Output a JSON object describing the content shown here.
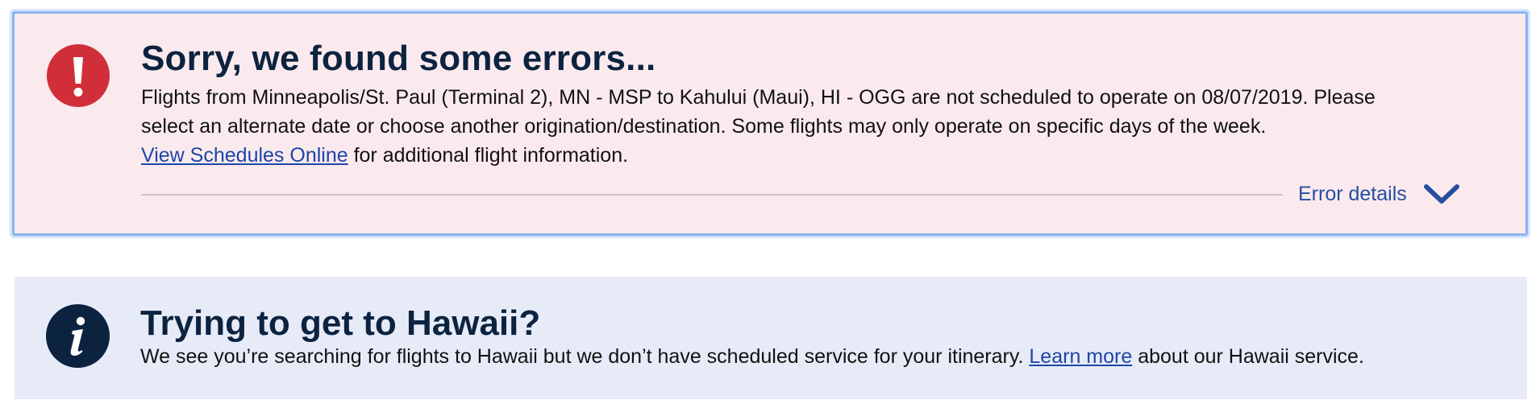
{
  "error_alert": {
    "icon": "exclamation-icon",
    "title": "Sorry, we found some errors...",
    "line1": "Flights from Minneapolis/St. Paul (Terminal 2), MN - MSP to Kahului (Maui), HI - OGG are not scheduled to operate on 08/07/2019. Please",
    "line2": "select an alternate date or choose another origination/destination. Some flights may only operate on specific days of the week.",
    "link_text": "View Schedules Online",
    "after_link": " for additional flight information.",
    "details_label": "Error details",
    "colors": {
      "background": "#faeaee",
      "icon": "#d02f3a",
      "border": "#8ab4f0"
    }
  },
  "info_alert": {
    "icon": "info-icon",
    "title": "Trying to get to Hawaii?",
    "body_before": "We see you’re searching for flights to Hawaii but we don’t have scheduled service for your itinerary. ",
    "link_text": "Learn more",
    "body_after": " about our Hawaii service.",
    "colors": {
      "background": "#e7ebf8",
      "icon": "#0c2340"
    }
  },
  "link_color": "#1d46a8",
  "heading_color": "#0c2340"
}
